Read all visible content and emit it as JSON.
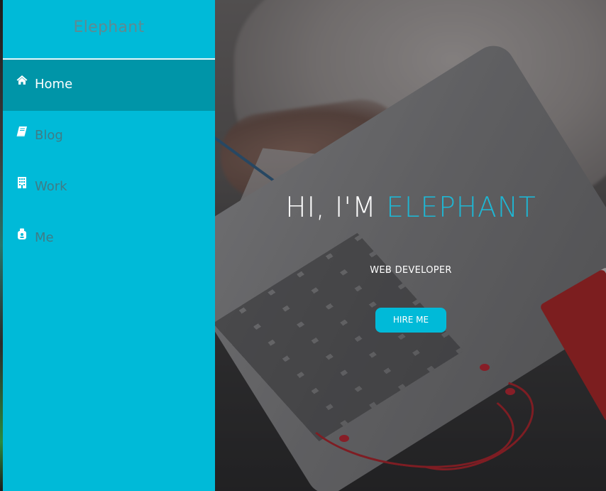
{
  "sidebar": {
    "brand": "Elephant",
    "items": [
      {
        "label": "Home",
        "icon": "home-icon",
        "active": true
      },
      {
        "label": "Blog",
        "icon": "book-icon",
        "active": false
      },
      {
        "label": "Work",
        "icon": "building-icon",
        "active": false
      },
      {
        "label": "Me",
        "icon": "user-bag-icon",
        "active": false
      }
    ]
  },
  "hero": {
    "greeting": "HI, I'M ",
    "name": "ELEPHANT",
    "subtitle": "WEB DEVELOPER",
    "cta_label": "HIRE ME"
  },
  "colors": {
    "accent": "#00bad8",
    "active_item": "#0095a8",
    "name_highlight": "#1fb6d3"
  }
}
